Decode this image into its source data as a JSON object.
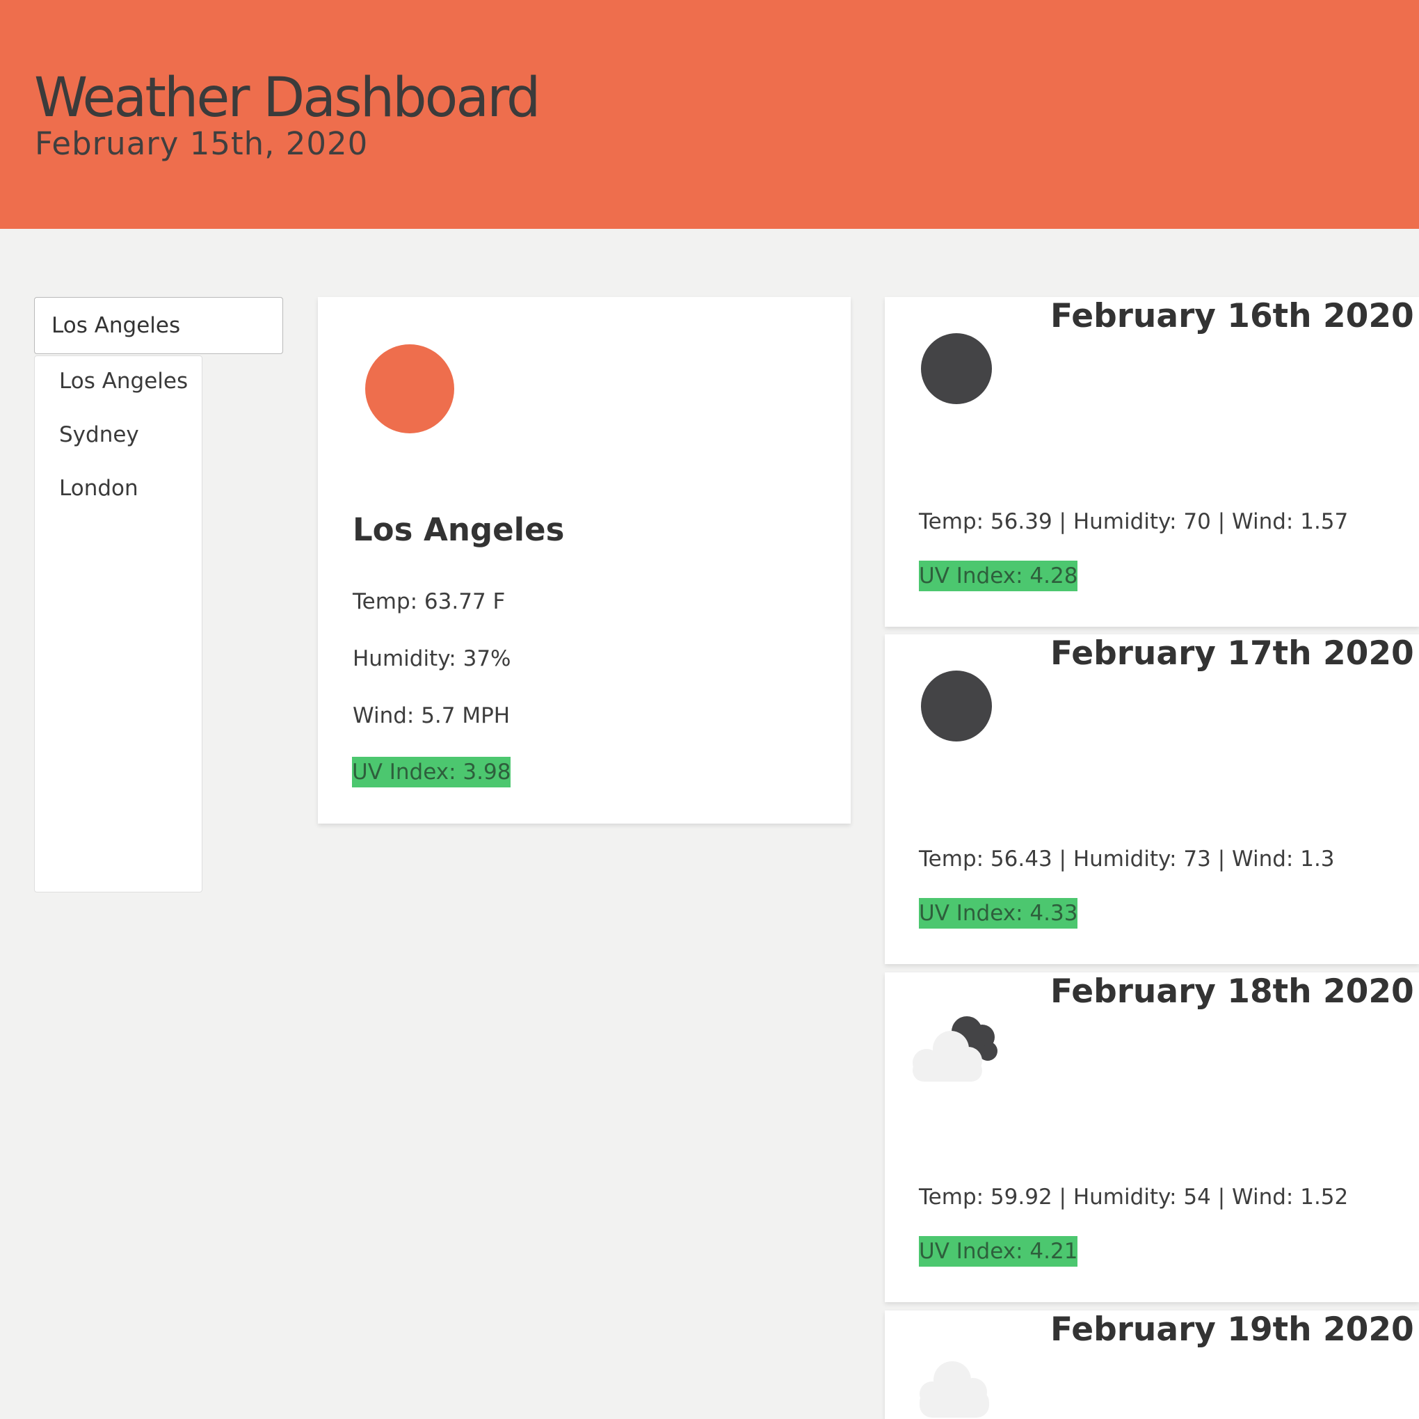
{
  "header": {
    "title": "Weather Dashboard",
    "date": "February 15th, 2020",
    "background_color": "#ee6e4d"
  },
  "search": {
    "value": "Los Angeles"
  },
  "city_list": {
    "items": [
      {
        "label": "Los Angeles"
      },
      {
        "label": "Sydney"
      },
      {
        "label": "London"
      }
    ]
  },
  "current": {
    "icon": "sun-icon",
    "city": "Los Angeles",
    "temp": "Temp: 63.77 F",
    "humidity": "Humidity: 37%",
    "wind": "Wind: 5.7 MPH",
    "uv": "UV Index: 3.98",
    "uv_color": "#4cc76f"
  },
  "forecast": [
    {
      "date": "February 16th 2020",
      "icon": "moon-icon",
      "stats": "Temp: 56.39 | Humidity: 70 | Wind: 1.57",
      "uv": "UV Index: 4.28"
    },
    {
      "date": "February 17th 2020",
      "icon": "moon-icon",
      "stats": "Temp: 56.43 | Humidity: 73 | Wind: 1.3",
      "uv": "UV Index: 4.33"
    },
    {
      "date": "February 18th 2020",
      "icon": "cloudy-night-icon",
      "stats": "Temp: 59.92 | Humidity: 54 | Wind: 1.52",
      "uv": "UV Index: 4.21"
    },
    {
      "date": "February 19th 2020",
      "icon": "cloud-icon",
      "stats": "",
      "uv": ""
    }
  ]
}
